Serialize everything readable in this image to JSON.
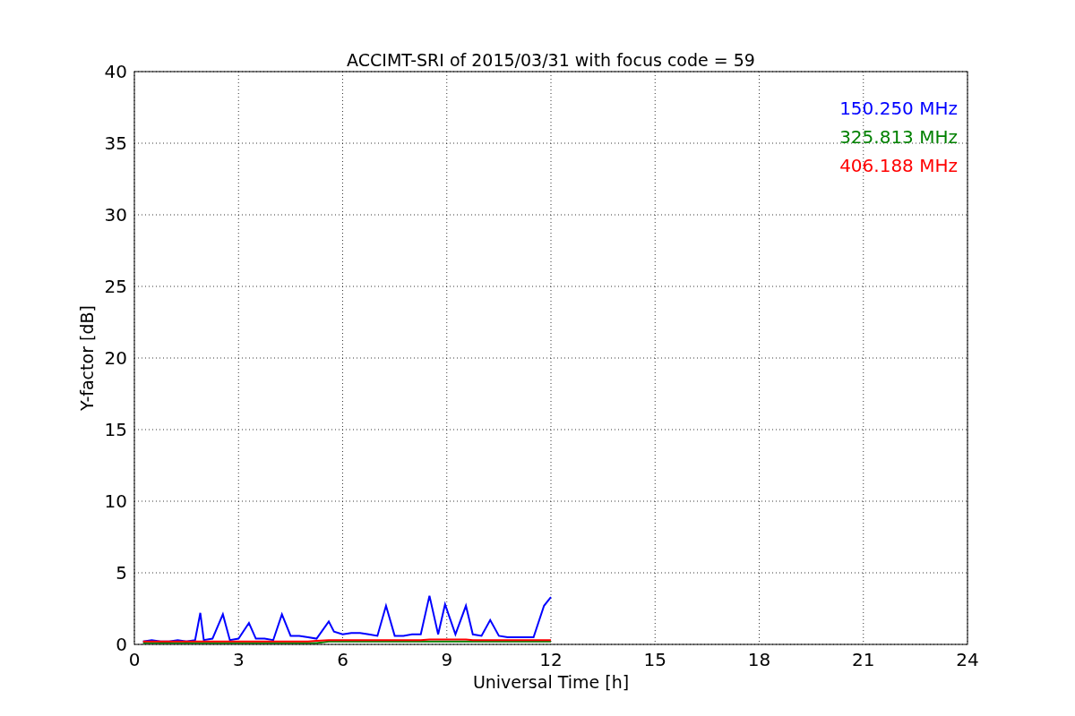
{
  "chart_data": {
    "type": "line",
    "title": "ACCIMT-SRI of 2015/03/31 with focus code = 59",
    "xlabel": "Universal Time [h]",
    "ylabel": "Y-factor [dB]",
    "grid": true,
    "xlim": [
      0,
      24
    ],
    "ylim": [
      0,
      40
    ],
    "xticks": [
      0,
      3,
      6,
      9,
      12,
      15,
      18,
      21,
      24
    ],
    "yticks": [
      0,
      5,
      10,
      15,
      20,
      25,
      30,
      35,
      40
    ],
    "x": [
      0.25,
      0.5,
      0.75,
      1,
      1.25,
      1.5,
      1.75,
      1.9,
      2,
      2.25,
      2.55,
      2.75,
      3,
      3.3,
      3.5,
      3.75,
      4,
      4.25,
      4.5,
      4.75,
      5,
      5.25,
      5.6,
      5.75,
      6,
      6.25,
      6.5,
      6.75,
      7,
      7.25,
      7.5,
      7.75,
      8,
      8.25,
      8.5,
      8.75,
      8.95,
      9.25,
      9.55,
      9.75,
      10,
      10.25,
      10.5,
      10.75,
      11,
      11.25,
      11.5,
      11.8,
      12
    ],
    "series": [
      {
        "name": "150.250 MHz",
        "color": "#0000ff",
        "values": [
          0.2,
          0.3,
          0.2,
          0.2,
          0.3,
          0.2,
          0.3,
          2.2,
          0.3,
          0.4,
          2.1,
          0.3,
          0.4,
          1.5,
          0.4,
          0.4,
          0.3,
          2.1,
          0.6,
          0.6,
          0.5,
          0.4,
          1.6,
          0.9,
          0.7,
          0.8,
          0.8,
          0.7,
          0.6,
          2.7,
          0.6,
          0.6,
          0.7,
          0.7,
          3.4,
          0.7,
          2.8,
          0.7,
          2.7,
          0.7,
          0.6,
          1.7,
          0.6,
          0.5,
          0.5,
          0.5,
          0.5,
          2.7,
          3.3
        ]
      },
      {
        "name": "325.813 MHz",
        "color": "#008000",
        "values": [
          0.1,
          0.1,
          0.1,
          0.1,
          0.1,
          0.1,
          0.1,
          0.1,
          0.1,
          0.1,
          0.1,
          0.1,
          0.1,
          0.1,
          0.1,
          0.1,
          0.1,
          0.1,
          0.1,
          0.1,
          0.1,
          0.1,
          0.2,
          0.2,
          0.2,
          0.2,
          0.2,
          0.2,
          0.2,
          0.2,
          0.2,
          0.2,
          0.2,
          0.2,
          0.2,
          0.2,
          0.2,
          0.2,
          0.2,
          0.2,
          0.2,
          0.2,
          0.2,
          0.2,
          0.2,
          0.2,
          0.2,
          0.2,
          0.2
        ]
      },
      {
        "name": "406.188 MHz",
        "color": "#ff0000",
        "values": [
          0.2,
          0.2,
          0.2,
          0.2,
          0.2,
          0.2,
          0.2,
          0.2,
          0.2,
          0.2,
          0.2,
          0.2,
          0.2,
          0.2,
          0.2,
          0.2,
          0.2,
          0.2,
          0.2,
          0.2,
          0.2,
          0.25,
          0.3,
          0.3,
          0.3,
          0.3,
          0.3,
          0.3,
          0.3,
          0.3,
          0.3,
          0.3,
          0.3,
          0.3,
          0.35,
          0.35,
          0.35,
          0.35,
          0.35,
          0.3,
          0.3,
          0.3,
          0.3,
          0.3,
          0.3,
          0.3,
          0.3,
          0.3,
          0.3
        ]
      }
    ]
  }
}
